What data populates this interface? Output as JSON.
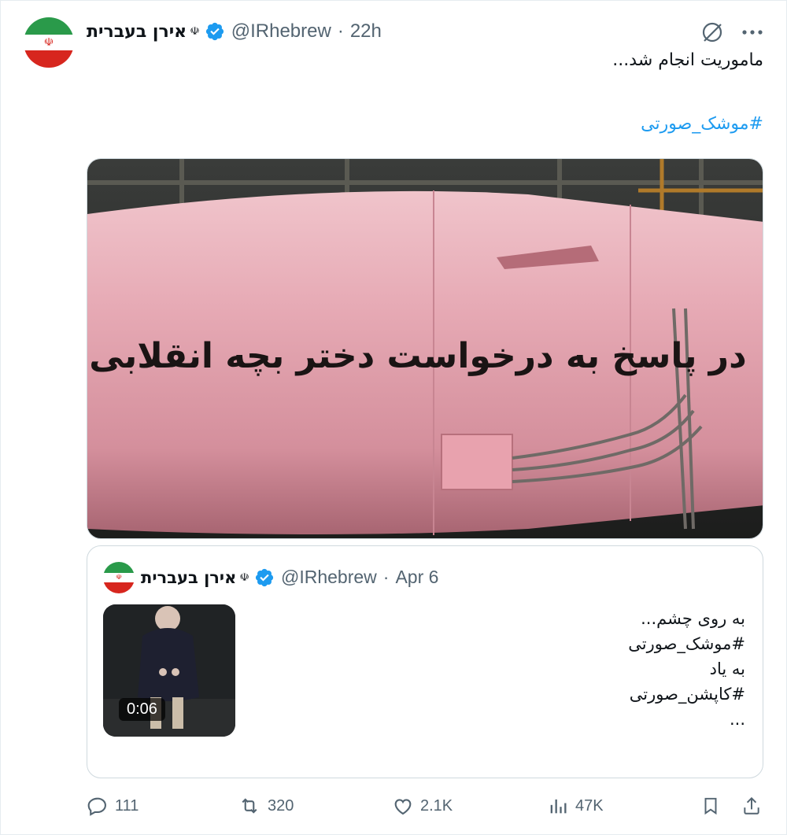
{
  "author": {
    "name": "אירן בעברית",
    "emblem": "☫",
    "handle": "@IRhebrew",
    "separator": "·",
    "time": "22h"
  },
  "tweet": {
    "text": "ماموریت انجام شد...",
    "hashtag": "#موشک_صورتی"
  },
  "media": {
    "missile_inscription": "در پاسخ به درخواست دختر بچه انقلابی"
  },
  "quote": {
    "author_name": "אירן בעברית",
    "emblem": "☫",
    "handle": "@IRhebrew",
    "separator": "·",
    "time": "Apr 6",
    "video_duration": "0:06",
    "lines": [
      "به روی چشم...",
      "#موشک_صورتی",
      "به یاد",
      "#کاپشن_صورتی",
      "..."
    ]
  },
  "actions": {
    "replies": "111",
    "reposts": "320",
    "likes": "2.1K",
    "views": "47K"
  },
  "colors": {
    "accent": "#1d9bf0",
    "muted": "#536471",
    "missile_pink": "#e8a8b4"
  }
}
